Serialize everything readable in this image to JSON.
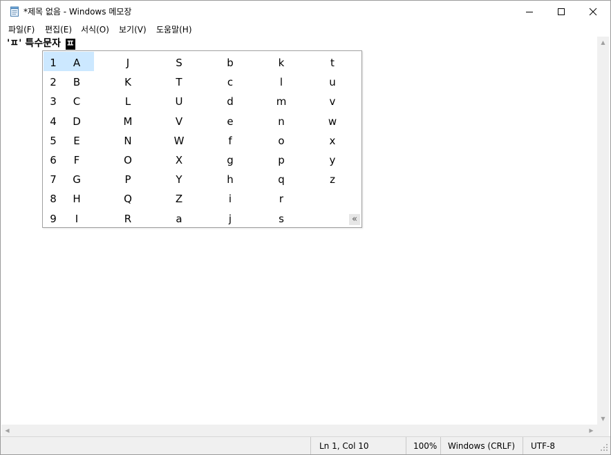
{
  "window": {
    "title": "*제목 없음 - Windows 메모장",
    "icon": "notepad-icon"
  },
  "menu": [
    {
      "label": "파일(F)"
    },
    {
      "label": "편집(E)"
    },
    {
      "label": "서식(O)"
    },
    {
      "label": "보기(V)"
    },
    {
      "label": "도움말(H)"
    }
  ],
  "editor": {
    "text": "'ㅍ' 특수문자 ",
    "composing": "ㅍ"
  },
  "candidates": {
    "selected_index": 1,
    "rows": [
      {
        "index": "1",
        "items": [
          "A",
          "J",
          "S",
          "b",
          "k",
          "t"
        ]
      },
      {
        "index": "2",
        "items": [
          "B",
          "K",
          "T",
          "c",
          "l",
          "u"
        ]
      },
      {
        "index": "3",
        "items": [
          "C",
          "L",
          "U",
          "d",
          "m",
          "v"
        ]
      },
      {
        "index": "4",
        "items": [
          "D",
          "M",
          "V",
          "e",
          "n",
          "w"
        ]
      },
      {
        "index": "5",
        "items": [
          "E",
          "N",
          "W",
          "f",
          "o",
          "x"
        ]
      },
      {
        "index": "6",
        "items": [
          "F",
          "O",
          "X",
          "g",
          "p",
          "y"
        ]
      },
      {
        "index": "7",
        "items": [
          "G",
          "P",
          "Y",
          "h",
          "q",
          "z"
        ]
      },
      {
        "index": "8",
        "items": [
          "H",
          "Q",
          "Z",
          "i",
          "r",
          ""
        ]
      },
      {
        "index": "9",
        "items": [
          "I",
          "R",
          "a",
          "j",
          "s",
          ""
        ]
      }
    ],
    "expand_label": "«"
  },
  "status": {
    "position": "Ln 1, Col 10",
    "zoom": "100%",
    "line_ending": "Windows (CRLF)",
    "encoding": "UTF-8"
  },
  "colors": {
    "selection": "#cce8ff",
    "statusbar": "#f0f0f0"
  }
}
